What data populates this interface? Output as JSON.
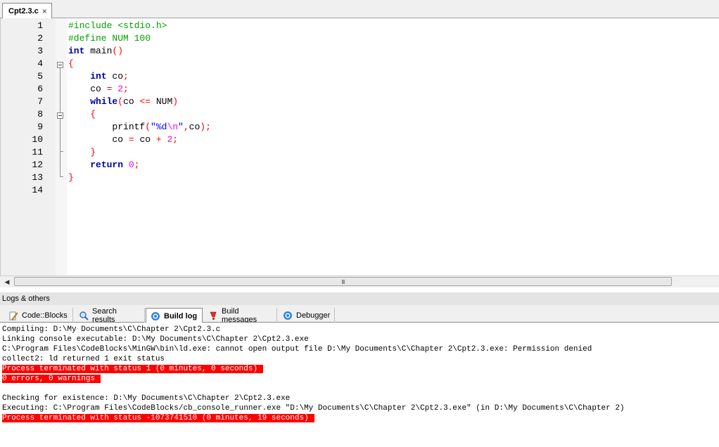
{
  "editor_tab": {
    "title": "Cpt2.3.c",
    "close_glyph": "×"
  },
  "code_lines": [
    {
      "n": "1",
      "parts": [
        {
          "t": "#include <stdio.h>",
          "c": "pp"
        }
      ]
    },
    {
      "n": "2",
      "parts": [
        {
          "t": "#define NUM 100",
          "c": "pp"
        }
      ]
    },
    {
      "n": "3",
      "parts": [
        {
          "t": "int",
          "c": "kw"
        },
        {
          "t": " main",
          "c": "id"
        },
        {
          "t": "()",
          "c": "op"
        }
      ]
    },
    {
      "n": "4",
      "parts": [
        {
          "t": "{",
          "c": "op"
        }
      ]
    },
    {
      "n": "5",
      "parts": [
        {
          "t": "    ",
          "c": "id"
        },
        {
          "t": "int",
          "c": "kw"
        },
        {
          "t": " co",
          "c": "id"
        },
        {
          "t": ";",
          "c": "op"
        }
      ]
    },
    {
      "n": "6",
      "parts": [
        {
          "t": "    co ",
          "c": "id"
        },
        {
          "t": "=",
          "c": "op"
        },
        {
          "t": " ",
          "c": "id"
        },
        {
          "t": "2",
          "c": "num"
        },
        {
          "t": ";",
          "c": "op"
        }
      ]
    },
    {
      "n": "7",
      "parts": [
        {
          "t": "    ",
          "c": "id"
        },
        {
          "t": "while",
          "c": "kw"
        },
        {
          "t": "(",
          "c": "op"
        },
        {
          "t": "co ",
          "c": "id"
        },
        {
          "t": "<=",
          "c": "op"
        },
        {
          "t": " NUM",
          "c": "id"
        },
        {
          "t": ")",
          "c": "op"
        }
      ]
    },
    {
      "n": "8",
      "parts": [
        {
          "t": "    ",
          "c": "id"
        },
        {
          "t": "{",
          "c": "op"
        }
      ]
    },
    {
      "n": "9",
      "parts": [
        {
          "t": "        printf",
          "c": "id"
        },
        {
          "t": "(",
          "c": "op"
        },
        {
          "t": "\"%d",
          "c": "str"
        },
        {
          "t": "\\n",
          "c": "esc"
        },
        {
          "t": "\"",
          "c": "str"
        },
        {
          "t": ",",
          "c": "op"
        },
        {
          "t": "co",
          "c": "id"
        },
        {
          "t": ");",
          "c": "op"
        }
      ]
    },
    {
      "n": "10",
      "parts": [
        {
          "t": "        co ",
          "c": "id"
        },
        {
          "t": "=",
          "c": "op"
        },
        {
          "t": " co ",
          "c": "id"
        },
        {
          "t": "+",
          "c": "op"
        },
        {
          "t": " ",
          "c": "id"
        },
        {
          "t": "2",
          "c": "num"
        },
        {
          "t": ";",
          "c": "op"
        }
      ]
    },
    {
      "n": "11",
      "parts": [
        {
          "t": "    ",
          "c": "id"
        },
        {
          "t": "}",
          "c": "op"
        }
      ]
    },
    {
      "n": "12",
      "parts": [
        {
          "t": "    ",
          "c": "id"
        },
        {
          "t": "return",
          "c": "kw"
        },
        {
          "t": " ",
          "c": "id"
        },
        {
          "t": "0",
          "c": "num"
        },
        {
          "t": ";",
          "c": "op"
        }
      ]
    },
    {
      "n": "13",
      "parts": [
        {
          "t": "}",
          "c": "op"
        }
      ]
    },
    {
      "n": "14",
      "parts": []
    }
  ],
  "scrollbar": {
    "left_arrow": "◀",
    "grip": "III"
  },
  "logs": {
    "header": "Logs & others",
    "tabs": [
      {
        "label": "Code::Blocks",
        "icon": "notepad-icon",
        "active": false
      },
      {
        "label": "Search results",
        "icon": "magnifier-icon",
        "active": false
      },
      {
        "label": "Build log",
        "icon": "gear-icon",
        "active": true
      },
      {
        "label": "Build messages",
        "icon": "message-icon",
        "active": false
      },
      {
        "label": "Debugger",
        "icon": "gear-icon",
        "active": false
      }
    ],
    "lines": [
      {
        "text": "Compiling: D:\\My Documents\\C\\Chapter 2\\Cpt2.3.c",
        "hl": false
      },
      {
        "text": "Linking console executable: D:\\My Documents\\C\\Chapter 2\\Cpt2.3.exe",
        "hl": false
      },
      {
        "text": "C:\\Program Files\\CodeBlocks\\MinGW\\bin\\ld.exe: cannot open output file D:\\My Documents\\C\\Chapter 2\\Cpt2.3.exe: Permission denied",
        "hl": false
      },
      {
        "text": "collect2: ld returned 1 exit status",
        "hl": false
      },
      {
        "text": "Process terminated with status 1 (0 minutes, 0 seconds)",
        "hl": true
      },
      {
        "text": "0 errors, 0 warnings",
        "hl": true
      },
      {
        "text": "",
        "hl": false
      },
      {
        "text": "Checking for existence: D:\\My Documents\\C\\Chapter 2\\Cpt2.3.exe",
        "hl": false
      },
      {
        "text": "Executing: C:\\Program Files\\CodeBlocks/cb_console_runner.exe \"D:\\My Documents\\C\\Chapter 2\\Cpt2.3.exe\" (in D:\\My Documents\\C\\Chapter 2)",
        "hl": false
      },
      {
        "text": "Process terminated with status -1073741510 (0 minutes, 19 seconds)",
        "hl": true
      }
    ]
  },
  "colors": {
    "error_highlight": "#ff0000",
    "preprocessor": "#00a000",
    "keyword": "#0000a0",
    "number": "#f000f0",
    "operator": "#ff0000"
  }
}
